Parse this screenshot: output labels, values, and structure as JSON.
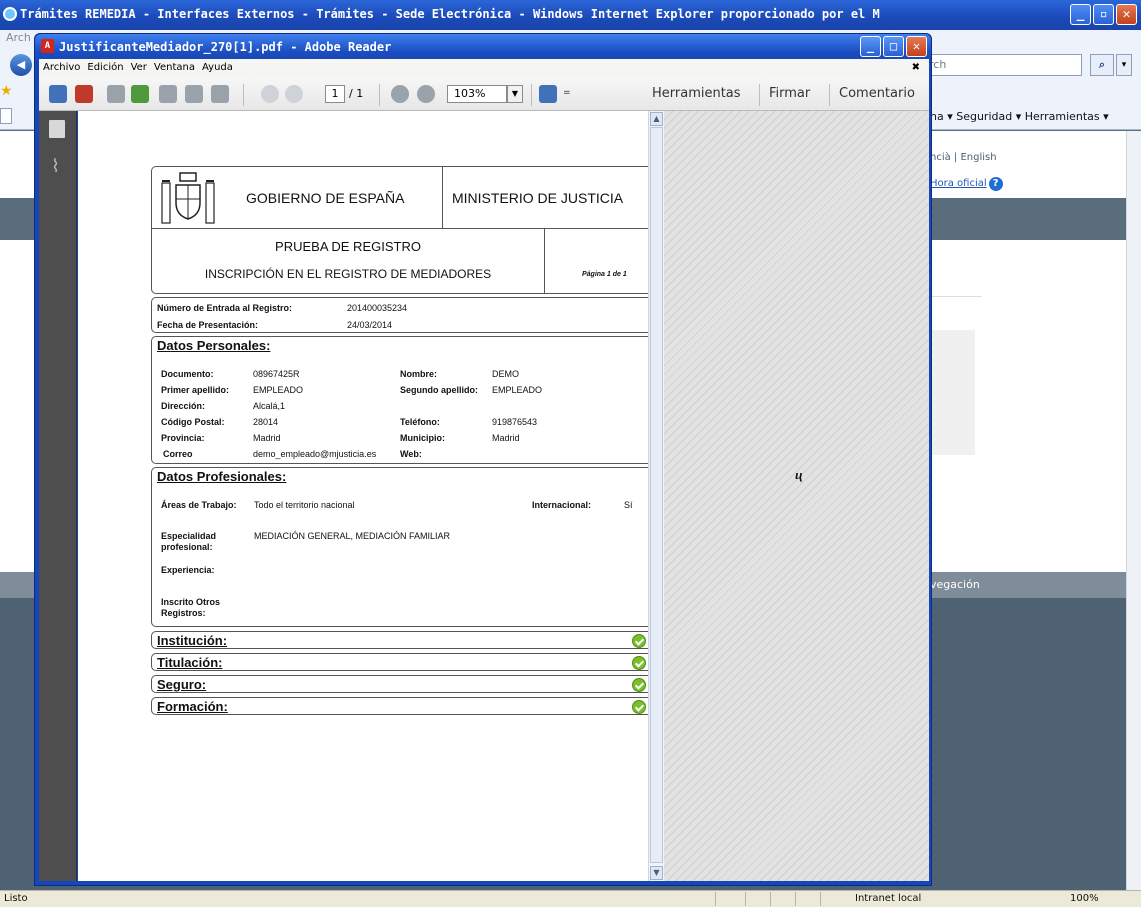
{
  "ie": {
    "title": "Trámites REMEDIA - Interfaces Externos - Trámites - Sede Electrónica - Windows Internet Explorer proporcionado por el Ministeri",
    "menu_partial": "Arch",
    "search_placeholder": "rch",
    "cmdbar": "na ▾   Seguridad ▾   Herramientas ▾",
    "site_lang": "ncià  |  English",
    "site_hora": "Hora oficial",
    "site_nav": "vegación",
    "status_left": "Listo",
    "status_zone": "Intranet local",
    "status_zoom": "100%"
  },
  "reader": {
    "title": "JustificanteMediador_270[1].pdf - Adobe Reader",
    "menu": [
      "Archivo",
      "Edición",
      "Ver",
      "Ventana",
      "Ayuda"
    ],
    "page_current": "1",
    "page_total": "/ 1",
    "zoom": "103%",
    "tools_link": "Herramientas",
    "sign_link": "Firmar",
    "comment_link": "Comentario"
  },
  "doc": {
    "gobierno": "GOBIERNO DE ESPAÑA",
    "ministerio": "MINISTERIO DE JUSTICIA",
    "prueba": "PRUEBA DE REGISTRO",
    "inscripcion": "INSCRIPCIÓN EN EL REGISTRO DE MEDIADORES",
    "pagina": "Página 1 de   1",
    "entrada_label": "Número de Entrada al Registro:",
    "entrada_value": "201400035234",
    "fecha_label": "Fecha de Presentación:",
    "fecha_value": "24/03/2014",
    "personales_title": "Datos Personales:",
    "personales": {
      "documento_label": "Documento:",
      "documento": "08967425R",
      "nombre_label": "Nombre:",
      "nombre": "DEMO",
      "apellido1_label": "Primer apellido:",
      "apellido1": "EMPLEADO",
      "apellido2_label": "Segundo apellido:",
      "apellido2": "EMPLEADO",
      "direccion_label": "Dirección:",
      "direccion": "Alcalá,1",
      "cp_label": "Código Postal:",
      "cp": "28014",
      "telefono_label": "Teléfono:",
      "telefono": "919876543",
      "provincia_label": "Provincia:",
      "provincia": "Madrid",
      "municipio_label": "Municipio:",
      "municipio": "Madrid",
      "correo_label": "Correo",
      "correo": "demo_empleado@mjusticia.es",
      "web_label": "Web:"
    },
    "profesionales_title": "Datos Profesionales:",
    "profesionales": {
      "areas_label": "Áreas de Trabajo:",
      "areas": "Todo el territorio nacional",
      "internacional_label": "Internacional:",
      "internacional": "Sí",
      "especialidad_label_1": "Especialidad",
      "especialidad_label_2": "profesional:",
      "especialidad": "MEDIACIÓN GENERAL, MEDIACIÓN FAMILIAR",
      "experiencia_label": "Experiencia:",
      "otros_label_1": "Inscrito Otros",
      "otros_label_2": "Registros:"
    },
    "sections": [
      "Institución:",
      "Titulación:",
      "Seguro:",
      "Formación:"
    ]
  }
}
